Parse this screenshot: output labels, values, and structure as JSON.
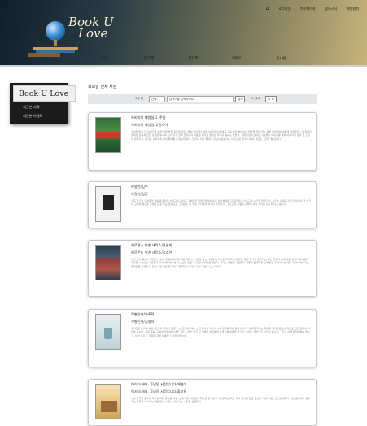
{
  "header": {
    "logo": {
      "line1": "Book U",
      "line2": "Love"
    },
    "top_nav": [
      "로그아웃",
      "마이페이지",
      "장바구니",
      "회원탈퇴"
    ],
    "menu": [
      "도서",
      "중고책",
      "전자책",
      "이벤트",
      "게시판"
    ],
    "home_icon": "home-icon"
  },
  "sidebar": {
    "title": "Book U Love",
    "items": [
      "최근본 서적",
      "최근본 이벤트"
    ]
  },
  "main": {
    "page_title": "북모달 전체 서점",
    "search": {
      "label": "1점 이",
      "select_value": "선택",
      "input_value": "검색어를 입력하세요",
      "search_button": "검색",
      "count_text": "9 / 10",
      "view_all_button": "전 체"
    },
    "books": [
      {
        "title": "아비지의 해방일지 /주원",
        "subtitle": "아버지의 해방일지/정지아",
        "description": "소설을 읽은 뒤 이야기를 쉽게 내려 놓지 못하게 된다. 빨치산이었던 아버지의 장례식장에서 사흘 동안 벌어지는 일들을 따라가며, 딸은 아버지를 새롭게 알게 된다. 이 작품은 유쾌한 웃음과 진한 감동을 동시에 선사한다. 한국 현대사의 아픔을 유머로 풀어낸 작가의 솜씨는 놀랍다. 장례식장에 찾아온 사람들의 이야기를 통해 아버지의 삶이 한 조각씩 맞춰지고, 독자는 아버지와 딸의 화해를 지켜보게 된다. 정지아 작가 특유의 입담이 돋보이는 이 소설은 우리 시대의 새로운 고전이 될 것이다."
      },
      {
        "title": "하얼빈/김우",
        "subtitle": "하얼빈/김훈",
        "description": "김훈 작가가 오랫동안 마음에 품어온 안중근의 이야기. 1909년 하얼빈역에서 이토 히로부미를 저격한 청년 안중근의 시간을 따라간다. 작가는 영웅의 신화가 아니라 한 인간의 고뇌와 결단을 간결하고 힘 있는 문장으로 그려낸다. 이 책은 우리에게 역사란 무엇인지, 그리고 한 사람의 선택이 어떤 의미를 갖는지 다시 묻는다."
      },
      {
        "title": "헤르몬스 위층 세탁소/홍연희",
        "subtitle": "헤르몬드 위층 세탁소/김호연",
        "description": "이번 도시 중심의 헤르몬스 빌딩 위층에 자리한 작은 세탁소. 그곳을 찾는 사람들의 사연은 저마다 다르지만, 옷을 맡기고 찾아가는 동안 그들의 삶에 작은 변화가 찾아온다. 따뜻한 시선으로 이웃들의 이야기를 엮어낸 이 소설은 일상 속 위로와 희망을 전한다. 작가는 평범한 사람들의 하루를 섬세하게 그려내며, 우리가 서로에게 기대어 살아가는 존재임을 일깨운다. 읽고 나면 마음 한구석이 깨끗하게 세탁된 듯한 기분이 드는 책이다."
      },
      {
        "title": "작별인사/유주혁",
        "subtitle": "작별인사/김영하",
        "description": "머지않은 미래의 평양. 인간과 기계의 경계가 흐려진 세계에서 소년 철이는 자신이 누구인지를 찾아 길을 떠난다. 김영하 작가는 특유의 날카로운 상상력으로 인간 존재의 의미를 묻는다. 삶과 죽음, 기억과 정체성에 대한 깊은 사유가 담긴 이 작품은 독자에게 오래도록 여운을 남긴다. 우리는 무엇으로 인간이 되는가, 그리고 어떻게 작별해야 하는가. 이 소설은 그 질문에 대한 아름답고 슬픈 대답이다."
      },
      {
        "title": "아이 오세요, 휴남동 서점입니다/채현아",
        "subtitle": "어서 오세요, 휴남동 서점입니다/황보름",
        "description": "서울 한적한 동네에 자리한 작은 휴남동 서점. 삶에 지친 사람들이 하나둘 모여들어 서로를 위로하고 다시 걸어갈 힘을 얻는다. 책과 사람, 그리고 대화가 있는 공간에서 펼쳐지는 따뜻한 이야기는 바쁜 일상 속 잠시 쉬어가는 시간을 선물한다."
      }
    ]
  },
  "colors": {
    "header_dark": "#0f1f2e",
    "header_gold": "#c7b37a",
    "sidebar_bg": "#1b1b1b",
    "search_bg": "#e4e6e8",
    "card_border": "#c9c9c9"
  }
}
